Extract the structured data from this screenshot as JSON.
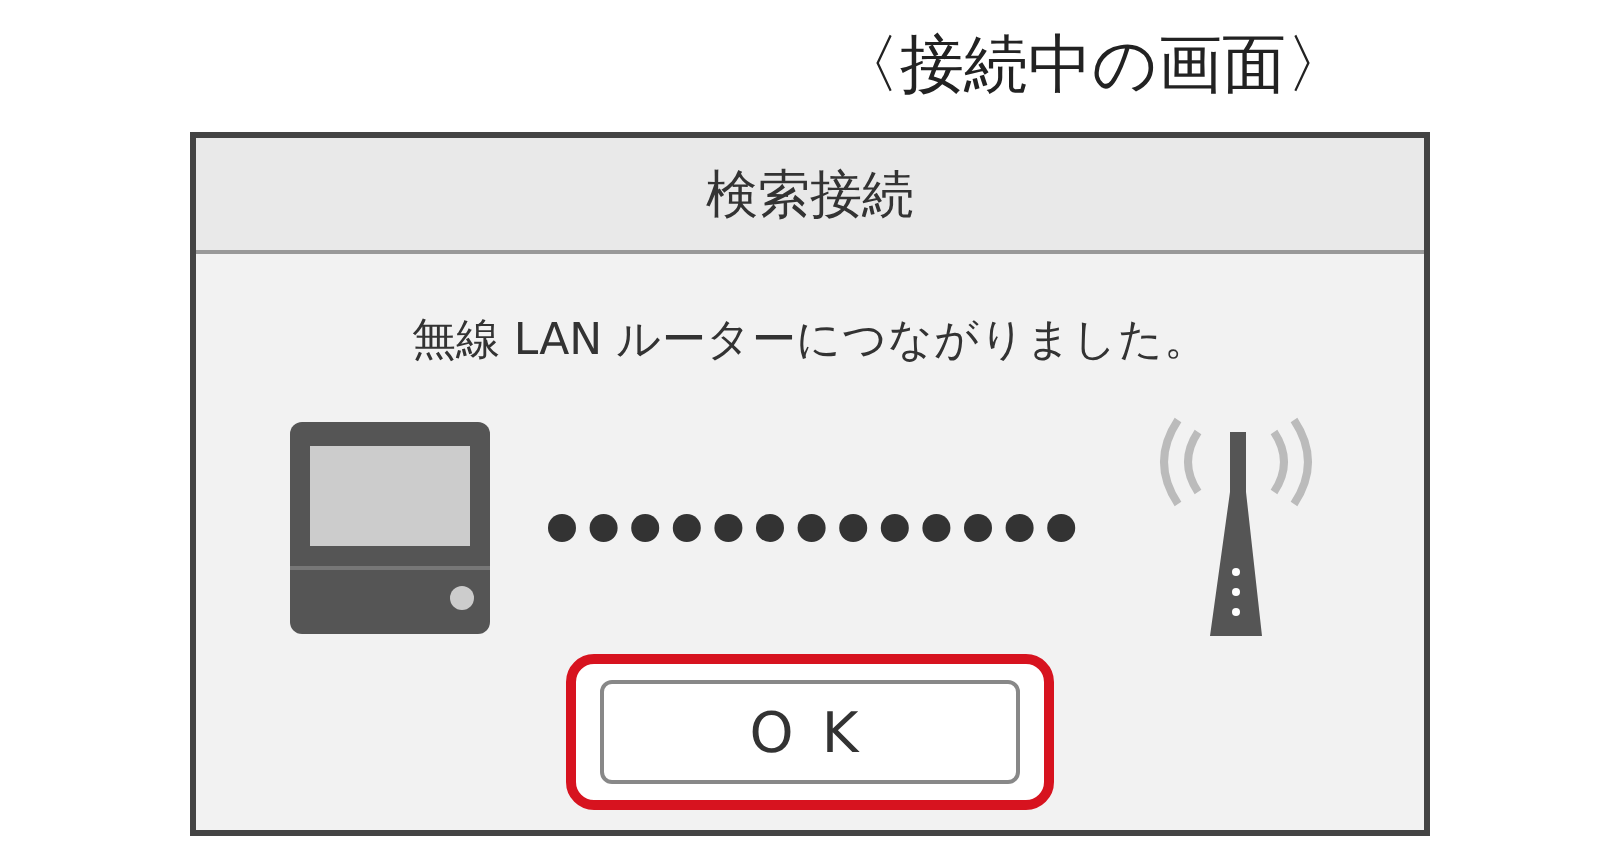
{
  "caption": "〈接続中の画面〉",
  "dialog": {
    "title": "検索接続",
    "message": "無線 LAN ルーターにつながりました。",
    "button": {
      "label": "OK",
      "highlighted": true
    }
  }
}
